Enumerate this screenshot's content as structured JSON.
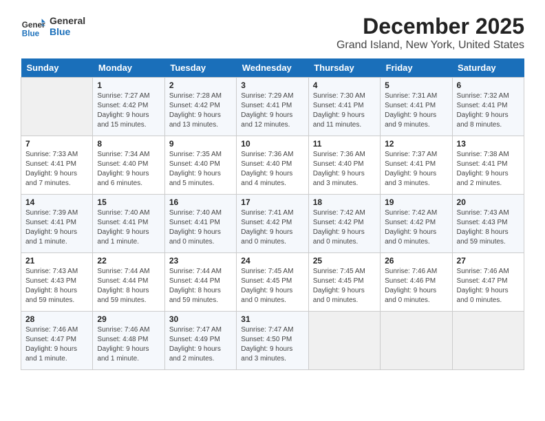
{
  "header": {
    "logo_line1": "General",
    "logo_line2": "Blue",
    "title": "December 2025",
    "subtitle": "Grand Island, New York, United States"
  },
  "days_of_week": [
    "Sunday",
    "Monday",
    "Tuesday",
    "Wednesday",
    "Thursday",
    "Friday",
    "Saturday"
  ],
  "weeks": [
    [
      {
        "day": "",
        "empty": true
      },
      {
        "day": "1",
        "sunrise": "7:27 AM",
        "sunset": "4:42 PM",
        "daylight": "9 hours and 15 minutes."
      },
      {
        "day": "2",
        "sunrise": "7:28 AM",
        "sunset": "4:42 PM",
        "daylight": "9 hours and 13 minutes."
      },
      {
        "day": "3",
        "sunrise": "7:29 AM",
        "sunset": "4:41 PM",
        "daylight": "9 hours and 12 minutes."
      },
      {
        "day": "4",
        "sunrise": "7:30 AM",
        "sunset": "4:41 PM",
        "daylight": "9 hours and 11 minutes."
      },
      {
        "day": "5",
        "sunrise": "7:31 AM",
        "sunset": "4:41 PM",
        "daylight": "9 hours and 9 minutes."
      },
      {
        "day": "6",
        "sunrise": "7:32 AM",
        "sunset": "4:41 PM",
        "daylight": "9 hours and 8 minutes."
      }
    ],
    [
      {
        "day": "7",
        "sunrise": "7:33 AM",
        "sunset": "4:41 PM",
        "daylight": "9 hours and 7 minutes."
      },
      {
        "day": "8",
        "sunrise": "7:34 AM",
        "sunset": "4:40 PM",
        "daylight": "9 hours and 6 minutes."
      },
      {
        "day": "9",
        "sunrise": "7:35 AM",
        "sunset": "4:40 PM",
        "daylight": "9 hours and 5 minutes."
      },
      {
        "day": "10",
        "sunrise": "7:36 AM",
        "sunset": "4:40 PM",
        "daylight": "9 hours and 4 minutes."
      },
      {
        "day": "11",
        "sunrise": "7:36 AM",
        "sunset": "4:40 PM",
        "daylight": "9 hours and 3 minutes."
      },
      {
        "day": "12",
        "sunrise": "7:37 AM",
        "sunset": "4:41 PM",
        "daylight": "9 hours and 3 minutes."
      },
      {
        "day": "13",
        "sunrise": "7:38 AM",
        "sunset": "4:41 PM",
        "daylight": "9 hours and 2 minutes."
      }
    ],
    [
      {
        "day": "14",
        "sunrise": "7:39 AM",
        "sunset": "4:41 PM",
        "daylight": "9 hours and 1 minute."
      },
      {
        "day": "15",
        "sunrise": "7:40 AM",
        "sunset": "4:41 PM",
        "daylight": "9 hours and 1 minute."
      },
      {
        "day": "16",
        "sunrise": "7:40 AM",
        "sunset": "4:41 PM",
        "daylight": "9 hours and 0 minutes."
      },
      {
        "day": "17",
        "sunrise": "7:41 AM",
        "sunset": "4:42 PM",
        "daylight": "9 hours and 0 minutes."
      },
      {
        "day": "18",
        "sunrise": "7:42 AM",
        "sunset": "4:42 PM",
        "daylight": "9 hours and 0 minutes."
      },
      {
        "day": "19",
        "sunrise": "7:42 AM",
        "sunset": "4:42 PM",
        "daylight": "9 hours and 0 minutes."
      },
      {
        "day": "20",
        "sunrise": "7:43 AM",
        "sunset": "4:43 PM",
        "daylight": "8 hours and 59 minutes."
      }
    ],
    [
      {
        "day": "21",
        "sunrise": "7:43 AM",
        "sunset": "4:43 PM",
        "daylight": "8 hours and 59 minutes."
      },
      {
        "day": "22",
        "sunrise": "7:44 AM",
        "sunset": "4:44 PM",
        "daylight": "8 hours and 59 minutes."
      },
      {
        "day": "23",
        "sunrise": "7:44 AM",
        "sunset": "4:44 PM",
        "daylight": "8 hours and 59 minutes."
      },
      {
        "day": "24",
        "sunrise": "7:45 AM",
        "sunset": "4:45 PM",
        "daylight": "9 hours and 0 minutes."
      },
      {
        "day": "25",
        "sunrise": "7:45 AM",
        "sunset": "4:45 PM",
        "daylight": "9 hours and 0 minutes."
      },
      {
        "day": "26",
        "sunrise": "7:46 AM",
        "sunset": "4:46 PM",
        "daylight": "9 hours and 0 minutes."
      },
      {
        "day": "27",
        "sunrise": "7:46 AM",
        "sunset": "4:47 PM",
        "daylight": "9 hours and 0 minutes."
      }
    ],
    [
      {
        "day": "28",
        "sunrise": "7:46 AM",
        "sunset": "4:47 PM",
        "daylight": "9 hours and 1 minute."
      },
      {
        "day": "29",
        "sunrise": "7:46 AM",
        "sunset": "4:48 PM",
        "daylight": "9 hours and 1 minute."
      },
      {
        "day": "30",
        "sunrise": "7:47 AM",
        "sunset": "4:49 PM",
        "daylight": "9 hours and 2 minutes."
      },
      {
        "day": "31",
        "sunrise": "7:47 AM",
        "sunset": "4:50 PM",
        "daylight": "9 hours and 3 minutes."
      },
      {
        "day": "",
        "empty": true
      },
      {
        "day": "",
        "empty": true
      },
      {
        "day": "",
        "empty": true
      }
    ]
  ]
}
